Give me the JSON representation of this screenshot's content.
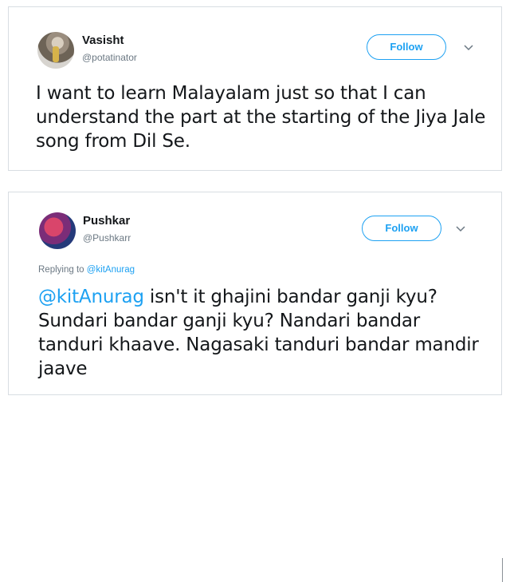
{
  "tweets": [
    {
      "user": {
        "name": "Vasisht",
        "handle": "@potatinator"
      },
      "follow_label": "Follow",
      "text": "I want to learn Malayalam just so that I can understand the part at the starting of the Jiya Jale song from Dil Se."
    },
    {
      "user": {
        "name": "Pushkar",
        "handle": "@Pushkarr"
      },
      "follow_label": "Follow",
      "replying_prefix": "Replying to ",
      "replying_mention": "@kitAnurag",
      "text_mention": "@kitAnurag",
      "text": " isn't it ghajini bandar ganji kyu? Sundari bandar ganji kyu? Nandari bandar tanduri khaave. Nagasaki tanduri bandar mandir jaave"
    }
  ],
  "icons": {
    "menu_caret": "chevron-down-icon"
  },
  "colors": {
    "accent": "#1da1f2",
    "secondary_text": "#6b7883",
    "border": "#d8dde2"
  }
}
